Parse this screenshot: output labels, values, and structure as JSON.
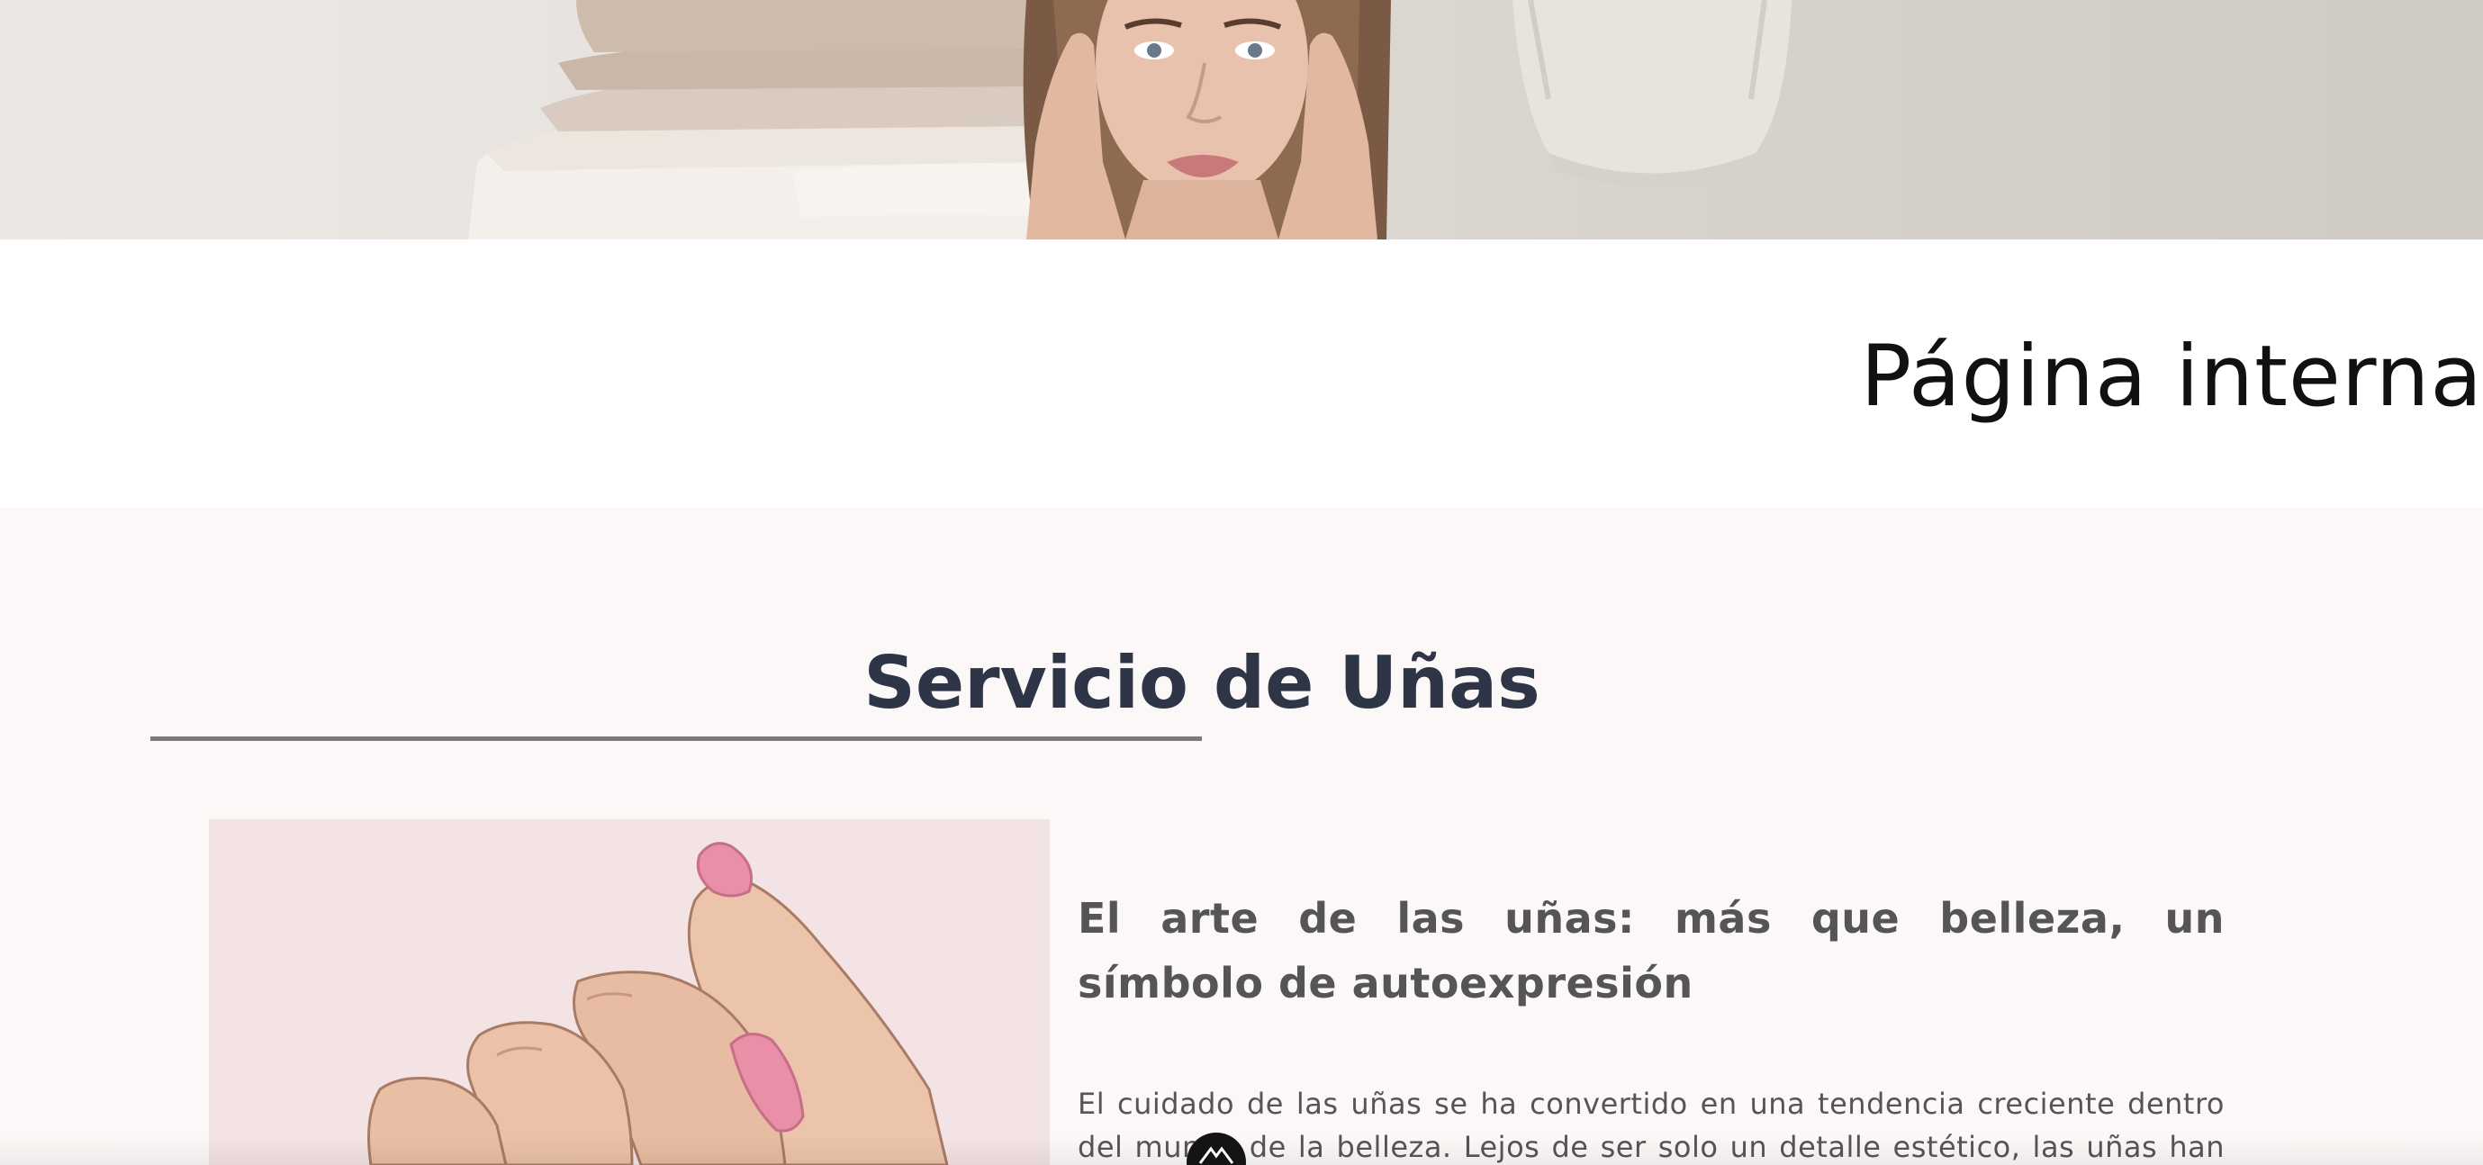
{
  "hero": {
    "image_name": "spa-model-banner-image"
  },
  "page": {
    "title": "Página interna"
  },
  "service": {
    "title": "Servicio de Uñas",
    "image_name": "nail-illustration-image",
    "heading": "El arte de las uñas: más que belleza, un símbolo de autoexpresión",
    "body": "El cuidado de las uñas se ha convertido en una tendencia creciente dentro del mundo de la belleza. Lejos de ser solo un detalle estético, las uñas han pasado"
  },
  "widget": {
    "icon": "mountain-logo-icon"
  },
  "colors": {
    "section_bg": "#fcf8f7",
    "title_color": "#2e3547",
    "text_color": "#555555",
    "rule_color": "#7a7a7a",
    "illustration_bg": "#f4e3e5",
    "nail_pink": "#e98fa8"
  }
}
